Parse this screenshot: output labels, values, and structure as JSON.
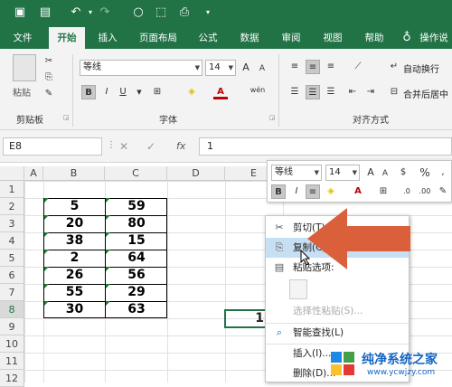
{
  "ribbon_tabs": [
    "文件",
    "开始",
    "插入",
    "页面布局",
    "公式",
    "数据",
    "审阅",
    "视图",
    "帮助",
    "操作说"
  ],
  "active_tab": "开始",
  "font": {
    "name": "等线",
    "size": "14",
    "bold": "B",
    "italic": "I",
    "underline": "U",
    "color_a": "A",
    "wen": "wén"
  },
  "clipboard": {
    "paste_label": "粘贴",
    "group": "剪贴板"
  },
  "groups": {
    "font": "字体",
    "align": "对齐方式"
  },
  "align": {
    "wrap": "自动换行",
    "merge": "合并后居中"
  },
  "formula_bar": {
    "name_box": "E8",
    "fx": "fx",
    "value": "1",
    "cancel": "✕",
    "enter": "✓"
  },
  "columns": [
    "A",
    "B",
    "C",
    "D",
    "E"
  ],
  "rows": [
    "1",
    "2",
    "3",
    "4",
    "5",
    "6",
    "7",
    "8",
    "9",
    "10",
    "11",
    "12"
  ],
  "table": [
    [
      "5",
      "59"
    ],
    [
      "20",
      "80"
    ],
    [
      "38",
      "15"
    ],
    [
      "2",
      "64"
    ],
    [
      "26",
      "56"
    ],
    [
      "55",
      "29"
    ],
    [
      "30",
      "63"
    ]
  ],
  "e8_value": "1",
  "mini_toolbar": {
    "font": "等线",
    "size": "14",
    "bold": "B",
    "italic": "I",
    "percent": "%"
  },
  "context_menu": [
    {
      "label": "剪切(T)",
      "icon": "scissors-icon"
    },
    {
      "label": "复制(C)",
      "icon": "copy-icon"
    },
    {
      "label": "粘贴选项:",
      "icon": "paste-icon"
    },
    {
      "label": "",
      "icon": "clipboard-icon"
    },
    {
      "label": "选择性粘贴(S)...",
      "icon": ""
    },
    {
      "label": "智能查找(L)",
      "icon": "search-icon"
    },
    {
      "label": "插入(I)...",
      "icon": ""
    },
    {
      "label": "删除(D)...",
      "icon": ""
    }
  ],
  "watermark": {
    "title": "纯净系统之家",
    "url": "www.ycwjzy.com"
  },
  "colors": {
    "excel_green": "#217346",
    "arrow": "#d9603b",
    "highlight": "#c6dff3"
  }
}
